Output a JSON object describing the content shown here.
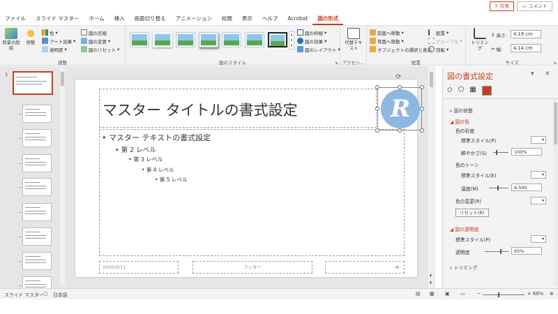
{
  "tabs": [
    "ファイル",
    "スライド マスター",
    "ホーム",
    "挿入",
    "画面切り替え",
    "アニメーション",
    "校閲",
    "表示",
    "ヘルプ",
    "Acrobat",
    "図の形式"
  ],
  "active_tab": "図の形式",
  "share_label": "共有",
  "comment_label": "コメント",
  "ribbon": {
    "adjust": {
      "label": "調整",
      "remove_bg": "背景の削除",
      "corrections": "修整",
      "color": "色",
      "art_effects": "アート効果",
      "transparency": "透明度",
      "compress": "図の圧縮",
      "change_picture": "図の変更",
      "reset_picture": "図のリセット"
    },
    "styles": {
      "label": "図のスタイル",
      "border": "図の枠線",
      "effects": "図の効果",
      "layout": "図のレイアウト"
    },
    "accessibility": {
      "label": "アクセシ...",
      "alt_text": "代替テキスト"
    },
    "arrange": {
      "label": "配置",
      "bring_forward": "前面へ移動",
      "send_backward": "背面へ移動",
      "selection_pane": "オブジェクトの選択と表示",
      "align": "配置",
      "group": "グループ化",
      "rotate": "回転"
    },
    "size": {
      "label": "サイズ",
      "crop": "トリミング",
      "height_label": "高さ:",
      "height": "4.19 cm",
      "width_label": "幅:",
      "width": "4.14 cm"
    }
  },
  "slide": {
    "title": "マスター タイトルの書式設定",
    "level1": "マスター テキストの書式設定",
    "level2": "第 2 レベル",
    "level3": "第 3 レベル",
    "level4": "第 4 レベル",
    "level5": "第 5 レベル",
    "date": "2020/4/11",
    "footer": "フッター",
    "page": "‹#›",
    "logo_letter": "R"
  },
  "thumb_number": "1",
  "pane": {
    "title": "図の書式設定",
    "sections": {
      "correction": "図の修整",
      "color": "図の色",
      "transparency": "図の透明度",
      "crop": "トリミング"
    },
    "saturation_header": "色の彩度",
    "preset_style": "標準スタイル(P)",
    "saturation_label": "鮮やかさ(S)",
    "saturation_value": "100%",
    "tone_header": "色のトーン",
    "tone_preset": "標準スタイル(E)",
    "temperature_label": "温度(M)",
    "temperature_value": "6,500",
    "recolor_label": "色の変更(R)",
    "reset_label": "リセット(R)",
    "transparency_preset": "標準スタイル(P)",
    "transparency_label": "透明度",
    "transparency_value": "65%"
  },
  "status": {
    "view": "スライド マスター",
    "language": "日本語",
    "zoom": "68%"
  },
  "colors": {
    "accent": "#c43e1c",
    "logo": "#8fb7e3"
  }
}
